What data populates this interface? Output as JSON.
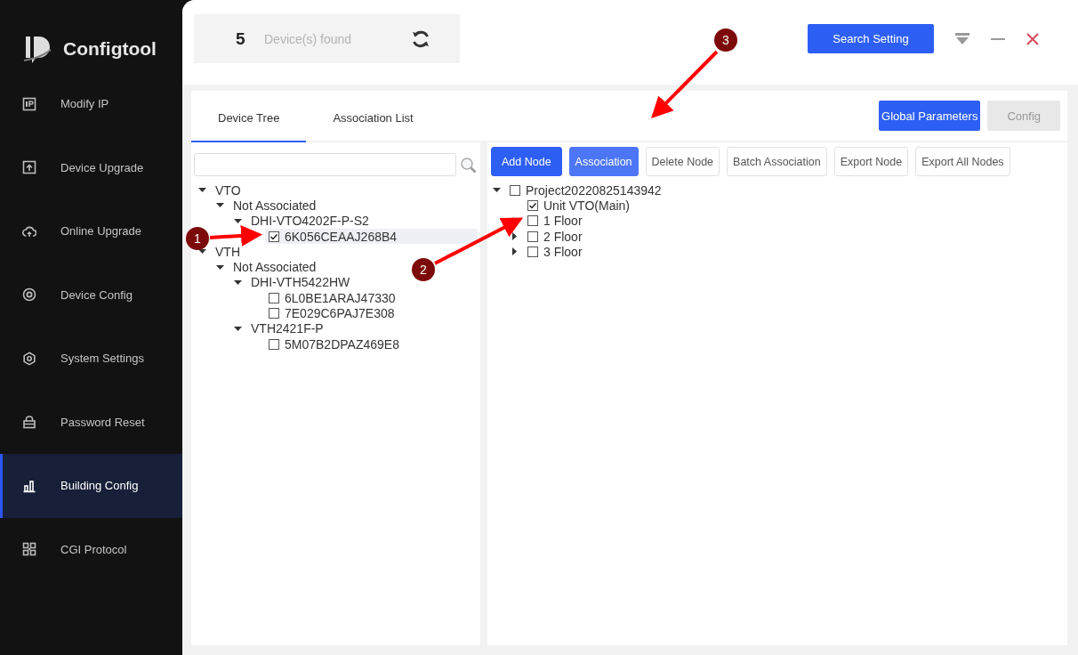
{
  "app": {
    "title": "Configtool"
  },
  "sidebar": {
    "items": [
      {
        "label": "Modify IP",
        "selected": false
      },
      {
        "label": "Device Upgrade",
        "selected": false
      },
      {
        "label": "Online Upgrade",
        "selected": false
      },
      {
        "label": "Device Config",
        "selected": false
      },
      {
        "label": "System Settings",
        "selected": false
      },
      {
        "label": "Password Reset",
        "selected": false
      },
      {
        "label": "Building Config",
        "selected": true
      },
      {
        "label": "CGI Protocol",
        "selected": false
      }
    ]
  },
  "header": {
    "device_count": "5",
    "device_count_label": "Device(s) found",
    "search_button": "Search Setting"
  },
  "tabs": [
    {
      "label": "Device Tree",
      "selected": true
    },
    {
      "label": "Association List",
      "selected": false
    }
  ],
  "panel_buttons": [
    {
      "label": "Global Parameters",
      "disabled": false
    },
    {
      "label": "Config",
      "disabled": true
    }
  ],
  "device_tree": {
    "nodes": [
      {
        "label": "VTO",
        "expanded": true,
        "children": [
          {
            "label": "Not Associated",
            "expanded": true,
            "children": [
              {
                "label": "DHI-VTO4202F-P-S2",
                "expanded": true,
                "children": [
                  {
                    "label": "6K056CEAAJ268B4",
                    "checked": true,
                    "selected": true
                  }
                ]
              }
            ]
          }
        ]
      },
      {
        "label": "VTH",
        "expanded": true,
        "children": [
          {
            "label": "Not Associated",
            "expanded": true,
            "children": [
              {
                "label": "DHI-VTH5422HW",
                "expanded": true,
                "children": [
                  {
                    "label": "6L0BE1ARAJ47330",
                    "checked": false,
                    "selected": false
                  },
                  {
                    "label": "7E029C6PAJ7E308",
                    "checked": false,
                    "selected": false
                  }
                ]
              },
              {
                "label": "VTH2421F-P",
                "expanded": true,
                "children": [
                  {
                    "label": "5M07B2DPAZ469E8",
                    "checked": false,
                    "selected": false
                  }
                ]
              }
            ]
          }
        ]
      }
    ]
  },
  "node_toolbar": [
    {
      "label": "Add Node",
      "kind": "primary"
    },
    {
      "label": "Association",
      "kind": "hovered"
    },
    {
      "label": "Delete Node",
      "kind": "plain"
    },
    {
      "label": "Batch Association",
      "kind": "plain"
    },
    {
      "label": "Export Node",
      "kind": "plain"
    },
    {
      "label": "Export All Nodes",
      "kind": "plain"
    }
  ],
  "node_tree": [
    {
      "label": "Project20220825143942",
      "expanded": true,
      "checked": false,
      "children": [
        {
          "label": "Unit VTO(Main)",
          "checked": true
        },
        {
          "label": "1 Floor",
          "expanded": false,
          "checked": false
        },
        {
          "label": "2 Floor",
          "expanded": false,
          "checked": false
        },
        {
          "label": "3 Floor",
          "expanded": false,
          "checked": false
        }
      ]
    }
  ],
  "callouts": [
    {
      "number": "1"
    },
    {
      "number": "2"
    },
    {
      "number": "3"
    }
  ]
}
